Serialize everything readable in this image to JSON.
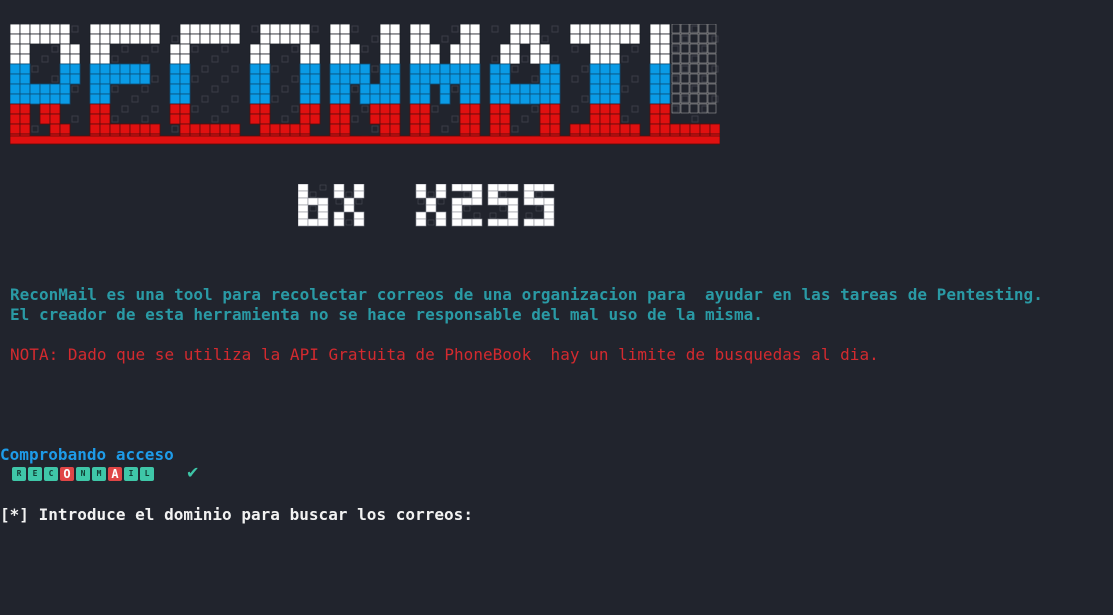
{
  "banner": {
    "name": "ReconMail ASCII banner",
    "colors": {
      "top": "#ffffff",
      "middle": "#0a9be6",
      "bottom": "#e01010",
      "shade": "#9a9a9a"
    }
  },
  "signature": {
    "text": "by x255",
    "color": "#ffffff"
  },
  "description": {
    "line1": "ReconMail es una tool para recolectar correos de una organizacion para  ayudar en las tareas de Pentesting.",
    "line2": "El creador de esta herramienta no se hace responsable del mal uso de la misma."
  },
  "note": "NOTA: Dado que se utiliza la API Gratuita de PhoneBook  hay un limite de busquedas al dia.",
  "status": {
    "text": "Comprobando acceso",
    "check_icon": "check-icon",
    "check_glyph": "✔"
  },
  "badge": {
    "letters": [
      {
        "ch": "R",
        "color": "#3fc7a8",
        "big": false
      },
      {
        "ch": "E",
        "color": "#3fc7a8",
        "big": false
      },
      {
        "ch": "C",
        "color": "#3fc7a8",
        "big": false
      },
      {
        "ch": "O",
        "color": "#e04646",
        "big": true
      },
      {
        "ch": "N",
        "color": "#3fc7a8",
        "big": false
      },
      {
        "ch": "M",
        "color": "#3fc7a8",
        "big": false
      },
      {
        "ch": "A",
        "color": "#e04646",
        "big": true
      },
      {
        "ch": "I",
        "color": "#3fc7a8",
        "big": false
      },
      {
        "ch": "L",
        "color": "#3fc7a8",
        "big": false
      }
    ]
  },
  "prompt": "[*] Introduce el dominio para buscar los correos:"
}
